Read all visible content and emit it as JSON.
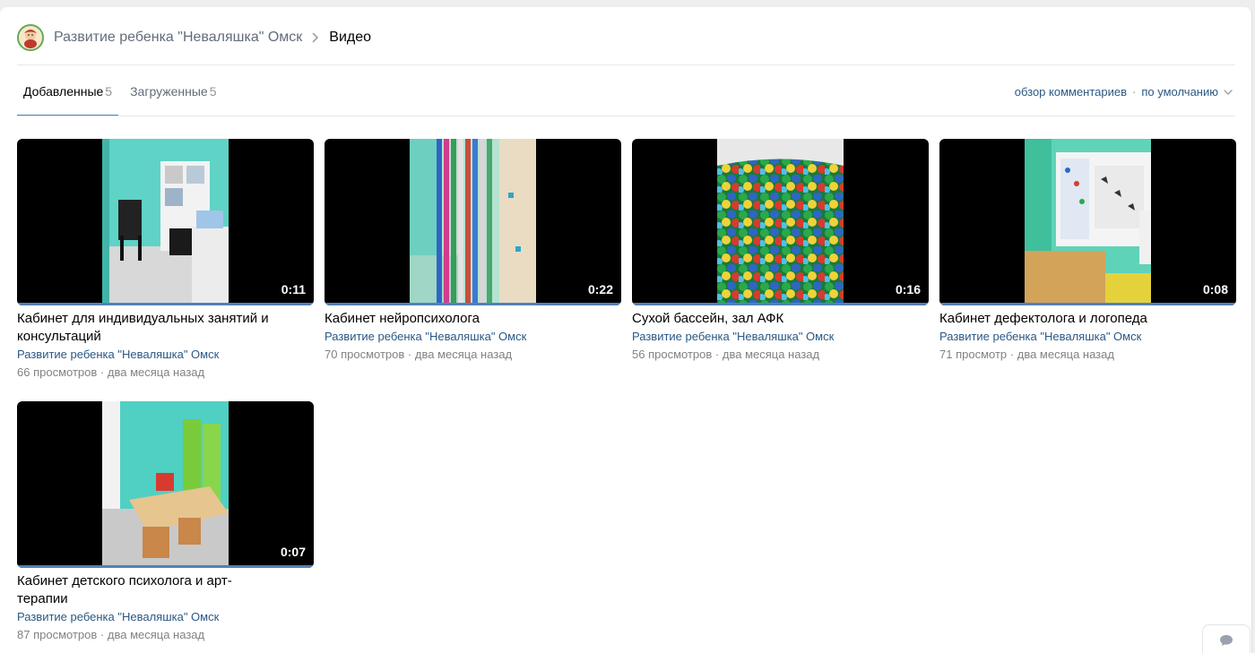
{
  "header": {
    "group_name": "Развитие ребенка \"Неваляшка\" Омск",
    "current": "Видео"
  },
  "tabs": [
    {
      "label": "Добавленные",
      "count": "5"
    },
    {
      "label": "Загруженные",
      "count": "5"
    }
  ],
  "sort": {
    "comments_label": "обзор комментариев",
    "separator": "·",
    "order_label": "по умолчанию"
  },
  "videos": [
    {
      "title": "Кабинет для индивидуальных занятий и консультаций",
      "author": "Развитие ребенка \"Неваляшка\" Омск",
      "views": "66 просмотров",
      "age": "два месяца назад",
      "duration": "0:11"
    },
    {
      "title": "Кабинет нейропсихолога",
      "author": "Развитие ребенка \"Неваляшка\" Омск",
      "views": "70 просмотров",
      "age": "два месяца назад",
      "duration": "0:22"
    },
    {
      "title": "Сухой бассейн, зал АФК",
      "author": "Развитие ребенка \"Неваляшка\" Омск",
      "views": "56 просмотров",
      "age": "два месяца назад",
      "duration": "0:16"
    },
    {
      "title": "Кабинет дефектолога и логопеда",
      "author": "Развитие ребенка \"Неваляшка\" Омск",
      "views": "71 просмотр",
      "age": "два месяца назад",
      "duration": "0:08"
    },
    {
      "title": "Кабинет детского психолога и арт-терапии",
      "author": "Развитие ребенка \"Неваляшка\" Омск",
      "views": "87 просмотров",
      "age": "два месяца назад",
      "duration": "0:07"
    }
  ],
  "meta_separator": "·",
  "colors": {
    "accent": "#5181b8",
    "link": "#2a5885",
    "muted": "#828282"
  }
}
